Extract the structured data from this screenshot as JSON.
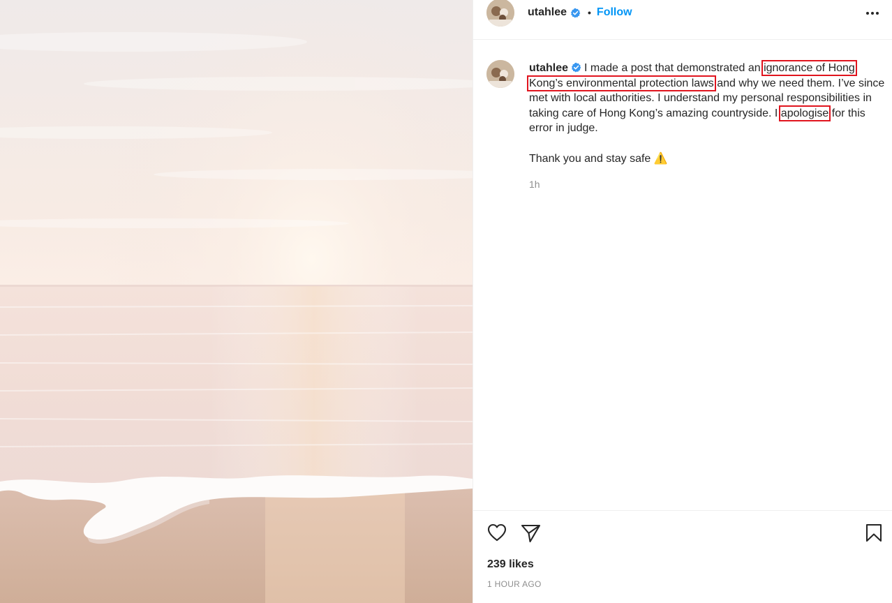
{
  "header": {
    "username": "utahlee",
    "separator": "•",
    "follow_label": "Follow"
  },
  "caption": {
    "username": "utahlee",
    "t1": "I made a post that demonstrated an ",
    "hl1": "ignorance of Hong",
    "t2": " ",
    "hl2": "Kong’s environmental protection laws",
    "t3": " and why we need them. I’ve since met with local authorities. I understand my personal responsibilities in taking care of Hong Kong’s amazing countryside. I ",
    "hl3": "apologise",
    "t4": " for this error in judge.",
    "p2": "Thank you and stay safe ",
    "emoji": "⚠️",
    "time": "1h"
  },
  "actions": {
    "like_icon": "heart-icon",
    "share_icon": "paper-plane-icon",
    "save_icon": "bookmark-icon",
    "likes": "239 likes",
    "timestamp": "1 HOUR AGO"
  },
  "colors": {
    "accent": "#0095f6",
    "verified": "#3897f0",
    "highlight_box": "#e0141e",
    "secondary_text": "#8e8e8e"
  }
}
